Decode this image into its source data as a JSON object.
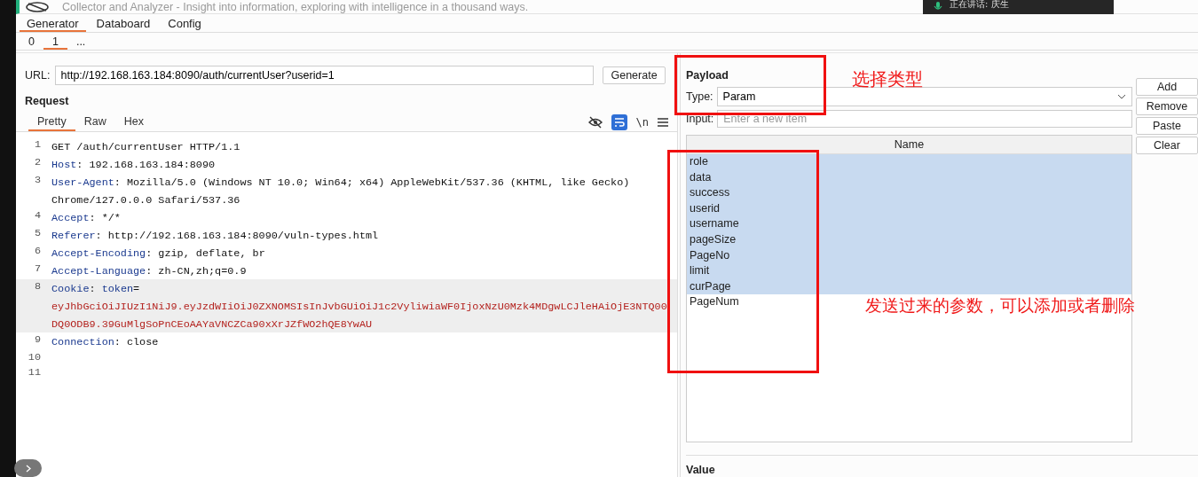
{
  "window": {
    "title": "Collector and Analyzer - Insight into information, exploring with intelligence in a thousand ways."
  },
  "call_overlay": {
    "text": "正在讲话: 庆生"
  },
  "main_tabs": [
    {
      "label": "Generator",
      "selected": true
    },
    {
      "label": "Databoard",
      "selected": false
    },
    {
      "label": "Config",
      "selected": false
    }
  ],
  "sub_tabs": [
    {
      "label": "0",
      "selected": false
    },
    {
      "label": "1",
      "selected": true
    },
    {
      "label": "...",
      "selected": false
    }
  ],
  "url": {
    "label": "URL:",
    "value": "http://192.168.163.184:8090/auth/currentUser?userid=1",
    "button": "Generate"
  },
  "request": {
    "title": "Request",
    "view_tabs": [
      {
        "label": "Pretty",
        "selected": true
      },
      {
        "label": "Raw",
        "selected": false
      },
      {
        "label": "Hex",
        "selected": false
      }
    ],
    "newline_toggle": "\\n",
    "wrap_on": true,
    "lines": [
      {
        "number": "1",
        "highlighted": false,
        "rows": [
          [
            {
              "kind": "plain",
              "text": "GET /auth/currentUser HTTP/1.1"
            }
          ]
        ]
      },
      {
        "number": "2",
        "highlighted": false,
        "rows": [
          [
            {
              "kind": "key",
              "text": "Host"
            },
            {
              "kind": "plain",
              "text": ": 192.168.163.184:8090"
            }
          ]
        ]
      },
      {
        "number": "3",
        "highlighted": false,
        "rows": [
          [
            {
              "kind": "key",
              "text": "User-Agent"
            },
            {
              "kind": "plain",
              "text": ": Mozilla/5.0 (Windows NT 10.0; Win64; x64) AppleWebKit/537.36 (KHTML, like Gecko)"
            }
          ],
          [
            {
              "kind": "plain",
              "text": "Chrome/127.0.0.0 Safari/537.36"
            }
          ]
        ]
      },
      {
        "number": "4",
        "highlighted": false,
        "rows": [
          [
            {
              "kind": "key",
              "text": "Accept"
            },
            {
              "kind": "plain",
              "text": ": */*"
            }
          ]
        ]
      },
      {
        "number": "5",
        "highlighted": false,
        "rows": [
          [
            {
              "kind": "key",
              "text": "Referer"
            },
            {
              "kind": "plain",
              "text": ": http://192.168.163.184:8090/vuln-types.html"
            }
          ]
        ]
      },
      {
        "number": "6",
        "highlighted": false,
        "rows": [
          [
            {
              "kind": "key",
              "text": "Accept-Encoding"
            },
            {
              "kind": "plain",
              "text": ": gzip, deflate, br"
            }
          ]
        ]
      },
      {
        "number": "7",
        "highlighted": false,
        "rows": [
          [
            {
              "kind": "key",
              "text": "Accept-Language"
            },
            {
              "kind": "plain",
              "text": ": zh-CN,zh;q=0.9"
            }
          ]
        ]
      },
      {
        "number": "8",
        "highlighted": true,
        "rows": [
          [
            {
              "kind": "key",
              "text": "Cookie"
            },
            {
              "kind": "plain",
              "text": ": "
            },
            {
              "kind": "key",
              "text": "token"
            },
            {
              "kind": "plain",
              "text": "="
            }
          ],
          [
            {
              "kind": "value",
              "text": "eyJhbGciOiJIUzI1NiJ9.eyJzdWIiOiJ0ZXNOMSIsInJvbGUiOiJ1c2VyliwiaWF0IjoxNzU0Mzk4MDgwLCJleHAiOjE3NTQ00"
            }
          ],
          [
            {
              "kind": "value",
              "text": "DQ0ODB9.39GuMlgSoPnCEoAAYaVNCZCa90xXrJZfWO2hQE8YwAU"
            }
          ]
        ]
      },
      {
        "number": "9",
        "highlighted": false,
        "rows": [
          [
            {
              "kind": "key",
              "text": "Connection"
            },
            {
              "kind": "plain",
              "text": ": close"
            }
          ]
        ]
      },
      {
        "number": "10",
        "highlighted": false,
        "rows": [
          []
        ]
      },
      {
        "number": "11",
        "highlighted": false,
        "rows": [
          []
        ]
      }
    ]
  },
  "payload": {
    "title": "Payload",
    "type_label": "Type:",
    "type_value": "Param",
    "input_label": "Input:",
    "input_placeholder": "Enter a new item",
    "buttons": [
      "Add",
      "Remove",
      "Paste",
      "Clear"
    ],
    "column": "Name",
    "items": [
      {
        "name": "role",
        "selected": true
      },
      {
        "name": "data",
        "selected": true
      },
      {
        "name": "success",
        "selected": true
      },
      {
        "name": "userid",
        "selected": true
      },
      {
        "name": "username",
        "selected": true
      },
      {
        "name": "pageSize",
        "selected": true
      },
      {
        "name": "PageNo",
        "selected": true
      },
      {
        "name": "limit",
        "selected": true
      },
      {
        "name": "curPage",
        "selected": true
      },
      {
        "name": "PageNum",
        "selected": false
      }
    ],
    "value_title": "Value"
  },
  "annotations": [
    {
      "text": "选择类型"
    },
    {
      "text": "发送过来的参数，可以添加或者删除"
    }
  ]
}
